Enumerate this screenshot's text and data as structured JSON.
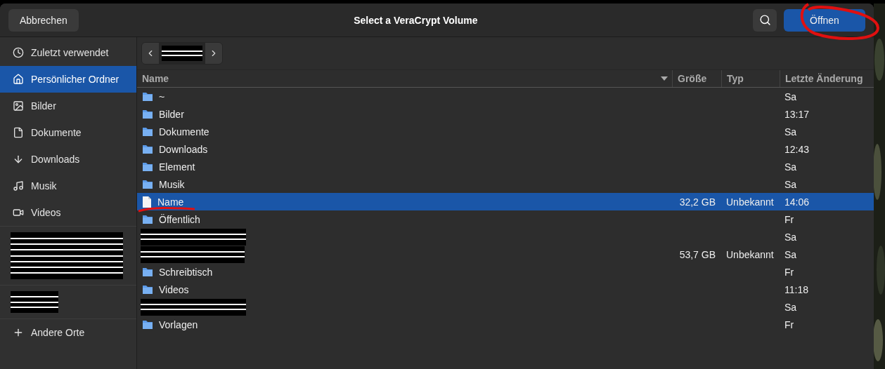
{
  "window": {
    "title": "Select a VeraCrypt Volume"
  },
  "header": {
    "cancel": "Abbrechen",
    "confirm": "Öffnen"
  },
  "sidebar": {
    "sections": [
      {
        "items": [
          {
            "kind": "recent",
            "label": "Zuletzt verwendet",
            "selected": false
          },
          {
            "kind": "home",
            "label": "Persönlicher Ordner",
            "selected": true
          },
          {
            "kind": "pictures",
            "label": "Bilder",
            "selected": false
          },
          {
            "kind": "documents",
            "label": "Dokumente",
            "selected": false
          },
          {
            "kind": "downloads",
            "label": "Downloads",
            "selected": false
          },
          {
            "kind": "music",
            "label": "Musik",
            "selected": false
          },
          {
            "kind": "videos",
            "label": "Videos",
            "selected": false
          }
        ]
      },
      {
        "items": [
          {
            "kind": "redacted_large"
          }
        ]
      },
      {
        "items": [
          {
            "kind": "redacted_small"
          }
        ]
      },
      {
        "items": [
          {
            "kind": "other",
            "label": "Andere Orte",
            "selected": false
          }
        ]
      }
    ]
  },
  "table": {
    "columns": [
      "Name",
      "Größe",
      "Typ",
      "Letzte Änderung"
    ],
    "rows": [
      {
        "kind": "folder",
        "name": "~",
        "modified": "Sa",
        "selected": false
      },
      {
        "kind": "folder",
        "name": "Bilder",
        "modified": "13:17",
        "selected": false
      },
      {
        "kind": "folder",
        "name": "Dokumente",
        "modified": "Sa",
        "selected": false
      },
      {
        "kind": "folder",
        "name": "Downloads",
        "modified": "12:43",
        "selected": false
      },
      {
        "kind": "folder",
        "name": "Element",
        "modified": "Sa",
        "selected": false
      },
      {
        "kind": "folder",
        "name": "Musik",
        "modified": "Sa",
        "selected": false
      },
      {
        "kind": "file",
        "name": "Name",
        "size": "32,2 GB",
        "type": "Unbekannt",
        "modified": "14:06",
        "selected": true
      },
      {
        "kind": "folder",
        "name": "Öffentlich",
        "modified": "Fr",
        "selected": false
      },
      {
        "kind": "redacted",
        "modified": "Sa",
        "selected": false
      },
      {
        "kind": "redacted",
        "size": "53,7 GB",
        "type": "Unbekannt",
        "modified": "Sa",
        "selected": false
      },
      {
        "kind": "folder",
        "name": "Schreibtisch",
        "modified": "Fr",
        "selected": false
      },
      {
        "kind": "folder",
        "name": "Videos",
        "modified": "11:18",
        "selected": false
      },
      {
        "kind": "redacted",
        "modified": "Sa",
        "selected": false
      },
      {
        "kind": "folder",
        "name": "Vorlagen",
        "modified": "Fr",
        "selected": false
      }
    ]
  },
  "markup": [
    {
      "kind": "circle"
    },
    {
      "kind": "underline"
    }
  ]
}
